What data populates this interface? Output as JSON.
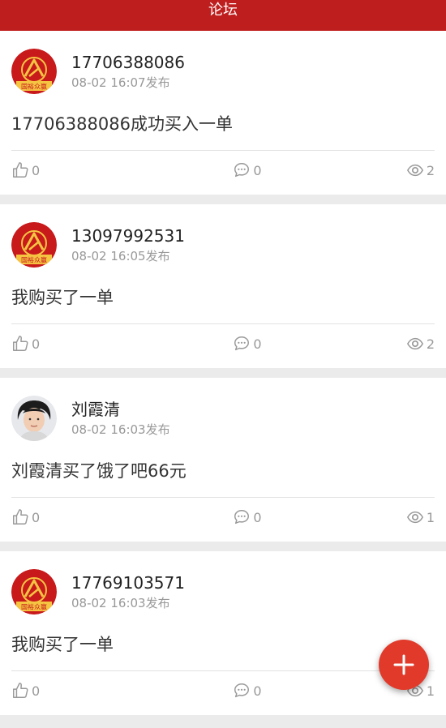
{
  "header": {
    "title": "论坛"
  },
  "posts": [
    {
      "author": "17706388086",
      "time": "08-02 16:07发布",
      "content": "17706388086成功买入一单",
      "avatar": "brand-logo",
      "avatar_text": "国裕众赢",
      "likes": "0",
      "comments": "0",
      "views": "2"
    },
    {
      "author": "13097992531",
      "time": "08-02 16:05发布",
      "content": "我购买了一单",
      "avatar": "brand-logo",
      "avatar_text": "国裕众赢",
      "likes": "0",
      "comments": "0",
      "views": "2"
    },
    {
      "author": "刘霞清",
      "time": "08-02 16:03发布",
      "content": "刘霞清买了饿了吧66元",
      "avatar": "user-photo",
      "likes": "0",
      "comments": "0",
      "views": "1"
    },
    {
      "author": "17769103571",
      "time": "08-02 16:03发布",
      "content": "我购买了一单",
      "avatar": "brand-logo",
      "avatar_text": "国裕众赢",
      "likes": "0",
      "comments": "0",
      "views": "1"
    }
  ],
  "icons": {
    "like": "thumbs-up-icon",
    "comment": "comment-icon",
    "views": "eye-icon",
    "fab": "plus-icon"
  },
  "colors": {
    "header": "#bf1e1e",
    "fab": "#e23a2a",
    "muted": "#999999"
  }
}
